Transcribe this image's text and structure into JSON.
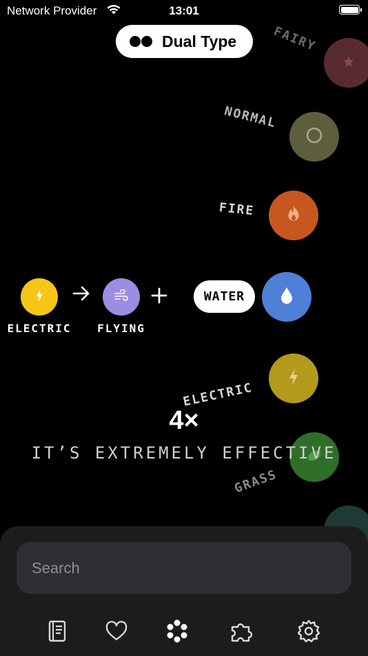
{
  "status_bar": {
    "carrier": "Network Provider",
    "time": "13:01"
  },
  "mode": {
    "label": "Dual Type"
  },
  "floating_types": [
    {
      "label": "FAIRY",
      "color": "#5a2a32",
      "icon": "star-icon"
    },
    {
      "label": "NORMAL",
      "color": "#5e5e3c",
      "icon": "circle-icon"
    },
    {
      "label": "FIRE",
      "color": "#c8571f",
      "icon": "flame-icon"
    },
    {
      "label": "WATER",
      "color": "#4f7fd6",
      "icon": "water-drop-icon"
    },
    {
      "label": "ELECTRIC",
      "color": "#b39a1c",
      "icon": "lightning-icon"
    },
    {
      "label": "GRASS",
      "color": "#2f6e28",
      "icon": "leaf-icon"
    }
  ],
  "combo": {
    "attacker": {
      "label": "ELECTRIC",
      "color": "#f5c518",
      "icon": "lightning-icon"
    },
    "defender_1": {
      "label": "FLYING",
      "color": "#9d8ce3",
      "icon": "wind-icon"
    },
    "defender_2": {
      "label": "WATER",
      "color": "#4f7fd6",
      "icon": "water-drop-icon"
    }
  },
  "result": {
    "multiplier": "4×",
    "text": "IT’S EXTREMELY EFFECTIVE"
  },
  "search": {
    "placeholder": "Search"
  },
  "tabs": [
    {
      "name": "pokedex",
      "icon": "book-icon"
    },
    {
      "name": "favorites",
      "icon": "heart-icon"
    },
    {
      "name": "types",
      "icon": "dots-icon"
    },
    {
      "name": "puzzle",
      "icon": "puzzle-icon"
    },
    {
      "name": "settings",
      "icon": "gear-icon"
    }
  ]
}
